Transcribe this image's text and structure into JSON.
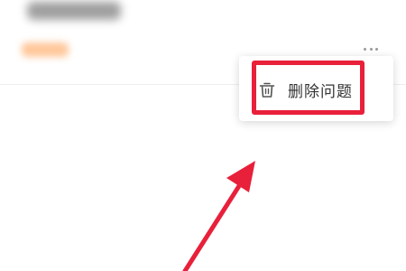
{
  "list_item": {
    "title_text": "",
    "tag_text": ""
  },
  "icons": {
    "more": "more-horizontal-icon",
    "delete": "trash-icon"
  },
  "menu": {
    "delete_label": "删除问题"
  },
  "annotation": {
    "highlight_color": "#e8203a",
    "arrow_color": "#e8203a"
  }
}
